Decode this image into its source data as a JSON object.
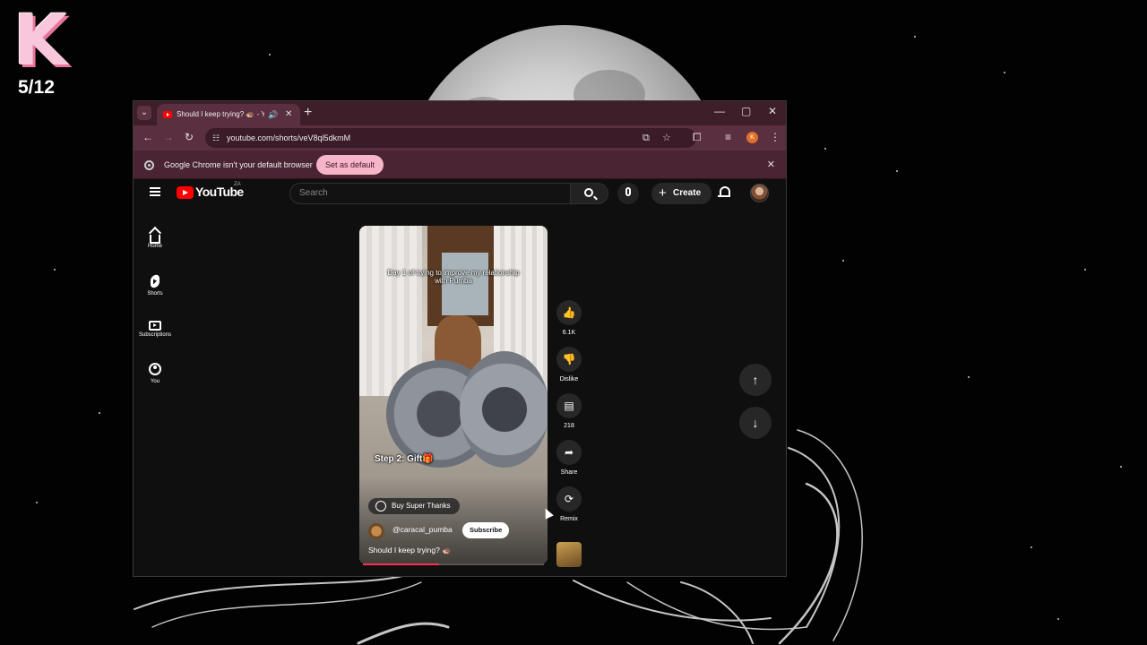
{
  "overlay": {
    "badge_letter": "K",
    "counter": "5/12"
  },
  "browser": {
    "tab_title": "Should I keep trying? 🦔 - Y",
    "url": "youtube.com/shorts/veV8ql5dkmM",
    "profile_initial": "K",
    "infobar_text": "Google Chrome isn't your default browser",
    "set_default_label": "Set as default"
  },
  "youtube": {
    "logo_text": "YouTube",
    "country_code": "ZA",
    "search_placeholder": "Search",
    "create_label": "Create",
    "guide": [
      {
        "label": "Home",
        "icon": "home-icon"
      },
      {
        "label": "Shorts",
        "icon": "shorts-icon"
      },
      {
        "label": "Subscriptions",
        "icon": "subscriptions-icon"
      },
      {
        "label": "You",
        "icon": "you-icon"
      }
    ]
  },
  "short": {
    "caption_top": "Day 1 of trying to improve my relationship with Pumba",
    "step_text": "Step 2: Gift🎁",
    "super_thanks_label": "Buy Super Thanks",
    "channel_handle": "@caracal_pumba",
    "subscribe_label": "Subscribe",
    "title": "Should I keep trying? 🦔",
    "progress": 0.42,
    "actions": [
      {
        "label": "6.1K",
        "icon": "like-icon"
      },
      {
        "label": "Dislike",
        "icon": "dislike-icon"
      },
      {
        "label": "218",
        "icon": "comment-icon"
      },
      {
        "label": "Share",
        "icon": "share-icon"
      },
      {
        "label": "Remix",
        "icon": "remix-icon"
      }
    ]
  },
  "colors": {
    "chrome_frame": "#3d1e29",
    "chrome_toolbar": "#5a2f3f",
    "set_default_button": "#f6b5c9",
    "youtube_red": "#ff0000",
    "progress_red": "#ff2d55"
  }
}
